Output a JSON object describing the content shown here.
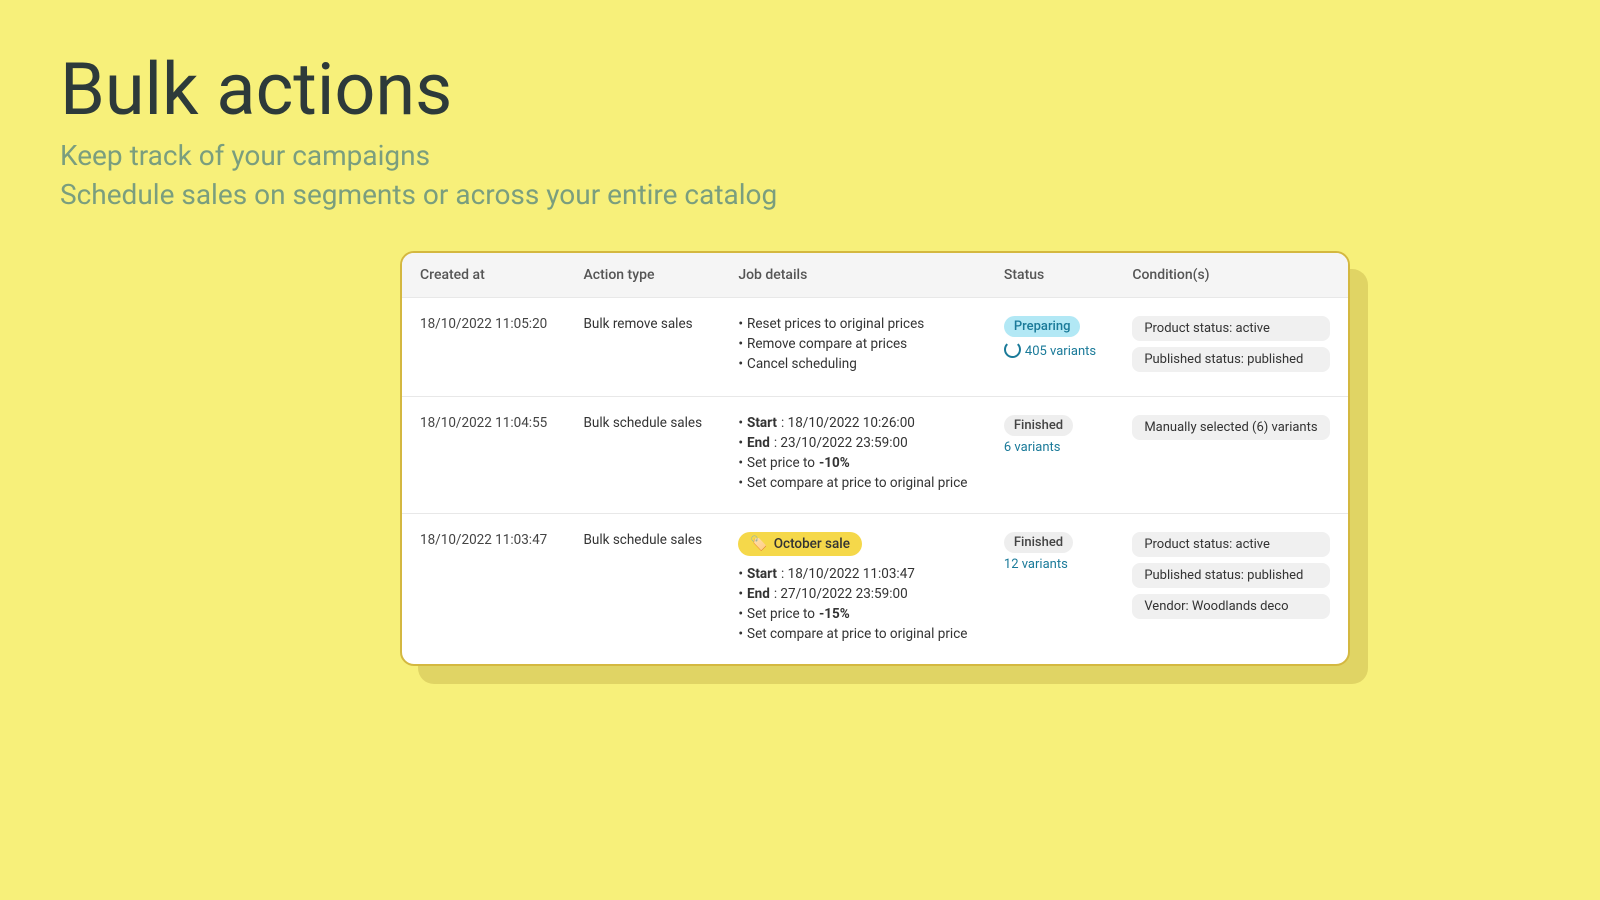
{
  "hero": {
    "title": "Bulk actions",
    "subtitle1": "Keep track of your campaigns",
    "subtitle2": "Schedule sales on segments or across your entire catalog"
  },
  "table": {
    "columns": [
      "Created at",
      "Action type",
      "Job details",
      "Status",
      "Condition(s)"
    ],
    "rows": [
      {
        "created_at": "18/10/2022 11:05:20",
        "action_type": "Bulk remove sales",
        "job_details": [
          {
            "text": "Reset prices to original prices",
            "bold_part": ""
          },
          {
            "text": "Remove compare at prices",
            "bold_part": ""
          },
          {
            "text": "Cancel scheduling",
            "bold_part": ""
          }
        ],
        "campaign_tag": null,
        "status_badge": "Preparing",
        "status_type": "preparing",
        "variants_text": "405 variants",
        "variants_loading": true,
        "conditions": [
          "Product status: active",
          "Published status: published"
        ]
      },
      {
        "created_at": "18/10/2022 11:04:55",
        "action_type": "Bulk schedule sales",
        "job_details": [
          {
            "text": "Start : 18/10/2022 10:26:00",
            "bold_part": "Start",
            "bold_val": ""
          },
          {
            "text": "End : 23/10/2022 23:59:00",
            "bold_part": "End",
            "bold_val": ""
          },
          {
            "text": "Set price to -10%",
            "bold_part": "-10%",
            "bold_val": "-10%"
          },
          {
            "text": "Set compare at price to original price",
            "bold_part": ""
          }
        ],
        "campaign_tag": null,
        "status_badge": "Finished",
        "status_type": "finished",
        "variants_text": "6 variants",
        "variants_loading": false,
        "conditions": [
          "Manually selected (6) variants"
        ]
      },
      {
        "created_at": "18/10/2022 11:03:47",
        "action_type": "Bulk schedule sales",
        "job_details": [
          {
            "text": "Start : 18/10/2022 11:03:47",
            "bold_part": "Start",
            "bold_val": ""
          },
          {
            "text": "End : 27/10/2022 23:59:00",
            "bold_part": "End",
            "bold_val": ""
          },
          {
            "text": "Set price to -15%",
            "bold_part": "-15%",
            "bold_val": "-15%"
          },
          {
            "text": "Set compare at price to original price",
            "bold_part": ""
          }
        ],
        "campaign_tag": "October sale",
        "status_badge": "Finished",
        "status_type": "finished",
        "variants_text": "12 variants",
        "variants_loading": false,
        "conditions": [
          "Product status: active",
          "Published status: published",
          "Vendor: Woodlands deco"
        ]
      }
    ]
  }
}
